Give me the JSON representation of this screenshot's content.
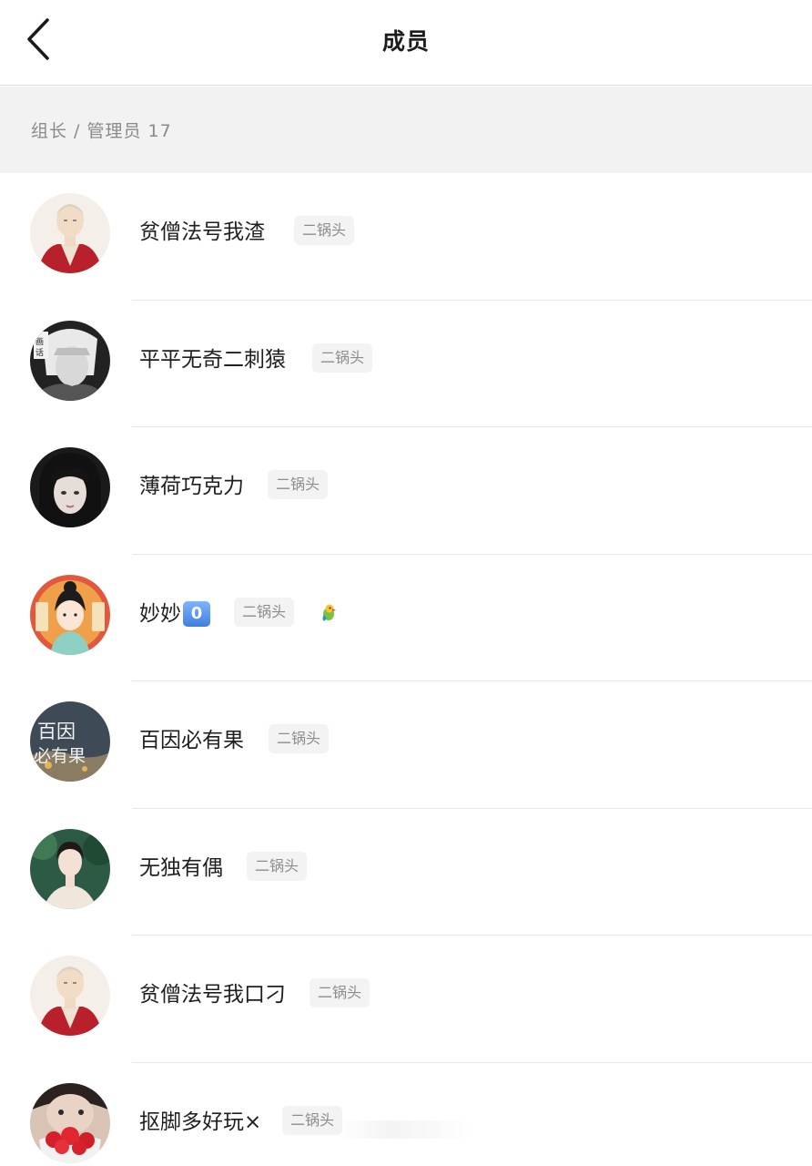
{
  "header": {
    "title": "成员",
    "back_icon": "chevron-left-icon"
  },
  "section": {
    "label": "组长 / 管理员 17"
  },
  "members": [
    {
      "name": "贫僧法号我渣",
      "badge": "二锅头"
    },
    {
      "name": "平平无奇二刺猿",
      "badge": "二锅头"
    },
    {
      "name": "薄荷巧克力",
      "badge": "二锅头"
    },
    {
      "name": "妙妙",
      "keycap": "0",
      "badge": "二锅头",
      "extra_icon": "parrot-icon"
    },
    {
      "name": "百因必有果",
      "badge": "二锅头",
      "avatar_text": [
        "百因",
        "必有果"
      ]
    },
    {
      "name": "无独有偶",
      "badge": "二锅头"
    },
    {
      "name": "贫僧法号我口刁",
      "badge": "二锅头"
    },
    {
      "name": "抠脚多好玩×",
      "badge": "二锅头"
    }
  ]
}
